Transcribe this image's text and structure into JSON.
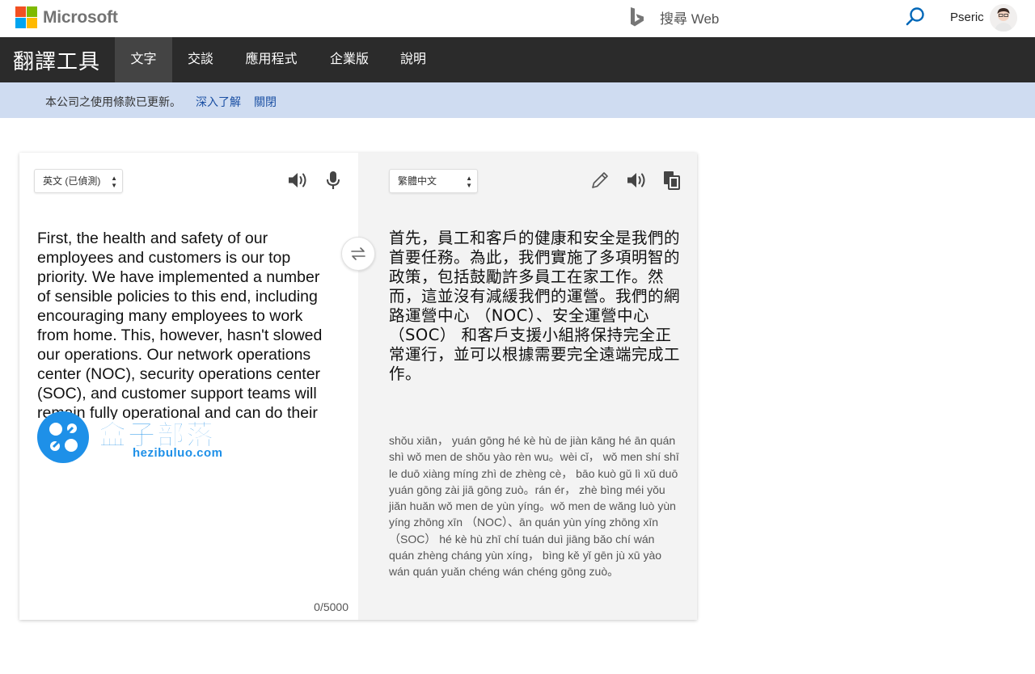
{
  "header": {
    "brand_name": "Microsoft",
    "bing_search_label": "搜尋 Web",
    "user_name": "Pseric",
    "logo_colors": [
      "#f25022",
      "#7fba00",
      "#00a4ef",
      "#ffb900"
    ]
  },
  "nav": {
    "app_title": "翻譯工具",
    "tabs": [
      {
        "label": "文字",
        "active": true
      },
      {
        "label": "交談",
        "active": false
      },
      {
        "label": "應用程式",
        "active": false
      },
      {
        "label": "企業版",
        "active": false
      },
      {
        "label": "說明",
        "active": false
      }
    ]
  },
  "notice": {
    "message": "本公司之使用條款已更新。",
    "learn_more": "深入了解",
    "close": "關閉"
  },
  "translator": {
    "source_language": "英文 (已偵測)",
    "target_language": "繁體中文",
    "source_text": "First, the health and safety of our employees and customers is our top priority. We have implemented a number of sensible policies to this end, including encouraging many employees to work from home. This, however, hasn't slowed our operations. Our network operations center (NOC), security operations center (SOC), and customer support teams will remain fully operational and can do their",
    "char_count": "0/5000",
    "translated_text": "首先，員工和客戶的健康和安全是我們的首要任務。為此，我們實施了多項明智的政策，包括鼓勵許多員工在家工作。然而，這並沒有減緩我們的運營。我們的網路運營中心 （NOC）、安全運營中心 （SOC） 和客戶支援小組將保持完全正常運行，並可以根據需要完全遠端完成工作。",
    "pinyin_text": "shǒu xiān， yuán gōng hé kè hù de jiàn kāng hé ān quán shì wǒ men de shǒu yào rèn wu。wèi cǐ， wǒ men shí shī le duō xiàng míng zhì de zhèng cè， bāo kuò gǔ lì xǔ duō yuán gōng zài jiā gōng zuò。rán ér， zhè bìng méi yǒu jiǎn huǎn wǒ men de yùn yíng。wǒ men de wǎng luò yùn yíng zhōng xīn （NOC）、ān quán yùn yíng zhōng xīn （SOC） hé kè hù zhī chí tuán duì jiāng bǎo chí wán quán zhèng cháng yùn xíng， bìng kě yǐ gēn jù xū yào wán quán yuǎn chéng wán chéng gōng zuò。",
    "icons": [
      "speaker-icon",
      "microphone-icon",
      "swap-icon",
      "pencil-icon",
      "copy-icon"
    ]
  },
  "watermark": {
    "title": "盒子部落",
    "url": "hezibuluo.com"
  }
}
